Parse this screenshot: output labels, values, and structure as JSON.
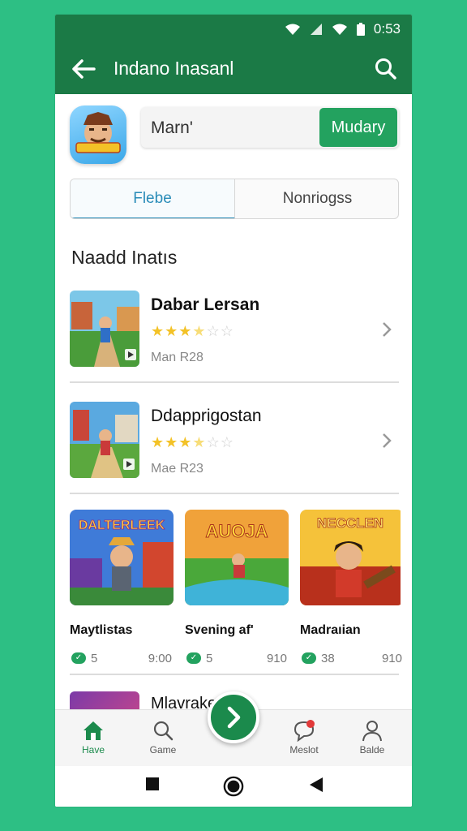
{
  "status": {
    "time": "0:53"
  },
  "appbar": {
    "title": "Indano Inasanl"
  },
  "search": {
    "value": "Marn'",
    "button_label": "Mudary"
  },
  "tabs": [
    {
      "label": "Flebe"
    },
    {
      "label": "Nonriogss"
    }
  ],
  "section": {
    "title": "Naadd Inatıs"
  },
  "list": [
    {
      "name": "Dabar Lersan",
      "rating": 3.5,
      "meta": "Man  R28"
    },
    {
      "name": "Ddapprigostan",
      "rating": 3.5,
      "meta": "Mae  R23"
    }
  ],
  "cards": [
    {
      "title": "Maytlistas",
      "art_text": "DALTERLEEK",
      "rating": "5",
      "size": "9:00"
    },
    {
      "title": "Svening af'",
      "art_text": "AUOJA",
      "rating": "5",
      "size": "910"
    },
    {
      "title": "Madraıian",
      "art_text": "NECCLEN",
      "rating": "38",
      "size": "910"
    }
  ],
  "partial_item": {
    "name": "Mlavrake"
  },
  "bottom_nav": [
    {
      "label": "Have",
      "icon": "home-icon"
    },
    {
      "label": "Game",
      "icon": "search-icon"
    },
    {
      "label": "Meslot",
      "icon": "chat-icon"
    },
    {
      "label": "Balde",
      "icon": "person-icon"
    }
  ],
  "colors": {
    "primary": "#1b7a46",
    "accent": "#23a25f",
    "tab_active": "#2a8cb8",
    "background": "#2dbf84"
  }
}
